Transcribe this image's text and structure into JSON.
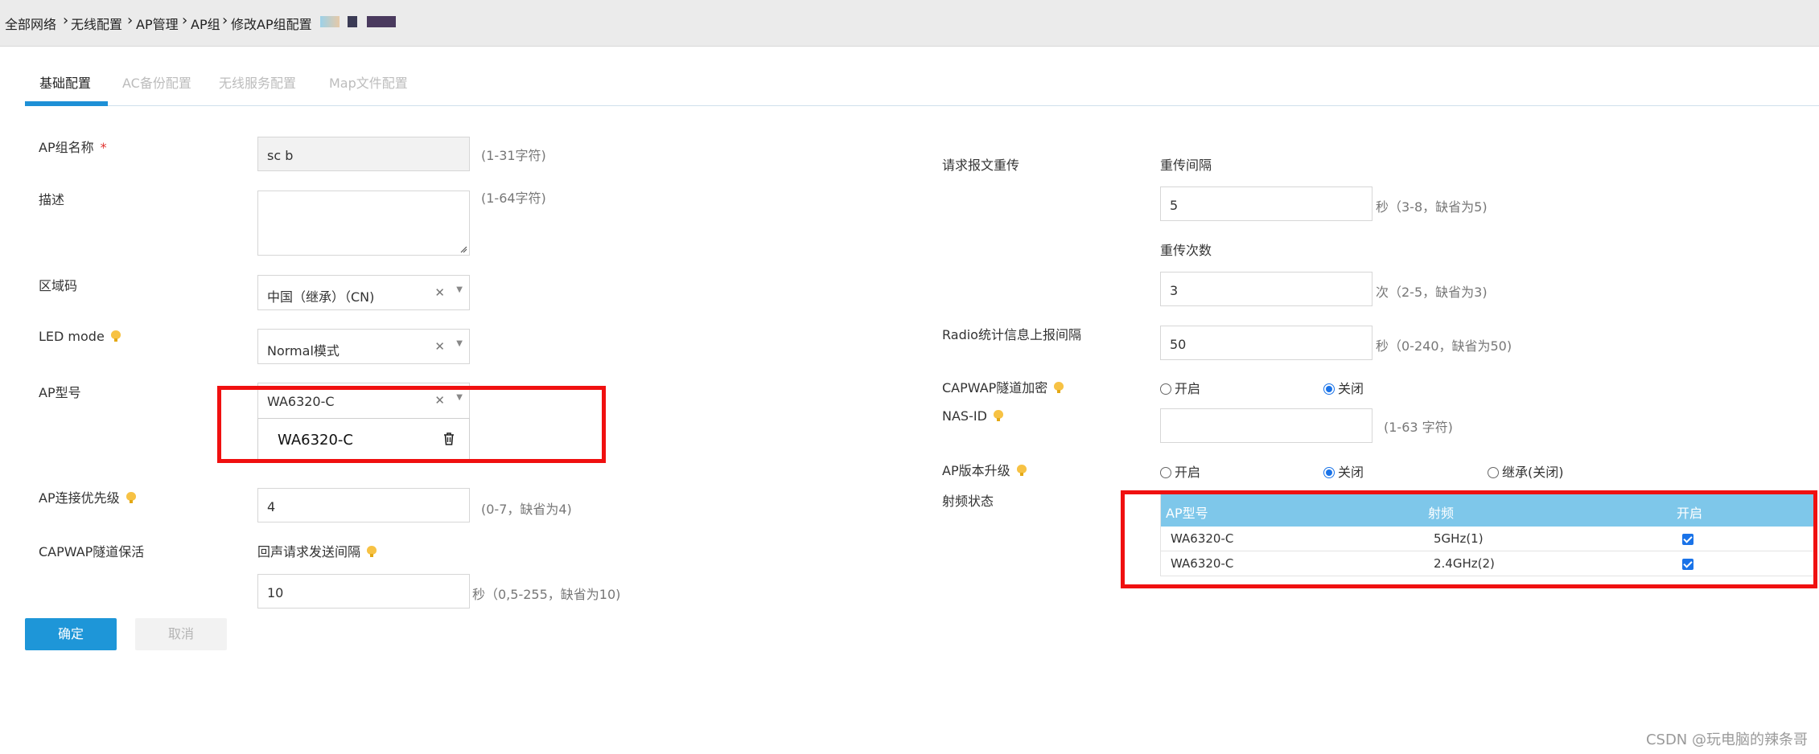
{
  "breadcrumb": {
    "items": [
      "全部网络",
      "无线配置",
      "AP管理",
      "AP组",
      "修改AP组配置"
    ],
    "separator": "›"
  },
  "tabs": [
    "基础配置",
    "AC备份配置",
    "无线服务配置",
    "Map文件配置"
  ],
  "left": {
    "group_name": {
      "label": "AP组名称",
      "required_mark": "*",
      "value": "sc      b",
      "hint": "(1-31字符)"
    },
    "description": {
      "label": "描述",
      "value": "",
      "hint": "(1-64字符)"
    },
    "region_code": {
      "label": "区域码",
      "value": "中国（继承）（CN)"
    },
    "led_mode": {
      "label": "LED mode",
      "value": "Normal模式"
    },
    "ap_model": {
      "label": "AP型号",
      "value": "WA6320-C",
      "selected_chip": "WA6320-C"
    },
    "priority": {
      "label": "AP连接优先级",
      "value": "4",
      "hint": "(0-7，缺省为4)"
    },
    "keepalive": {
      "label": "CAPWAP隧道保活",
      "sub_label": "回声请求发送间隔",
      "value": "10",
      "hint": "秒（0,5-255，缺省为10)"
    }
  },
  "right": {
    "retransmit": {
      "label": "请求报文重传",
      "interval_label": "重传间隔",
      "interval_value": "5",
      "interval_hint": "秒（3-8，缺省为5)",
      "count_label": "重传次数",
      "count_value": "3",
      "count_hint": "次（2-5，缺省为3)"
    },
    "radio_stats": {
      "label": "Radio统计信息上报间隔",
      "value": "50",
      "hint": "秒（0-240，缺省为50)"
    },
    "capwap_encrypt": {
      "label": "CAPWAP隧道加密",
      "options": [
        "开启",
        "关闭"
      ],
      "selected": "关闭"
    },
    "nas_id": {
      "label": "NAS-ID",
      "value": "",
      "hint": "(1-63 字符)"
    },
    "ap_upgrade": {
      "label": "AP版本升级",
      "options": [
        "开启",
        "关闭",
        "继承(关闭)"
      ],
      "selected": "关闭"
    },
    "radio_state": {
      "label": "射频状态",
      "columns": [
        "AP型号",
        "射频",
        "开启"
      ],
      "rows": [
        {
          "model": "WA6320-C",
          "radio": "5GHz(1)",
          "enabled": true
        },
        {
          "model": "WA6320-C",
          "radio": "2.4GHz(2)",
          "enabled": true
        }
      ]
    }
  },
  "buttons": {
    "ok": "确定",
    "cancel": "取消"
  },
  "watermark": "CSDN @玩电脑的辣条哥",
  "colors": {
    "accent": "#1e96d8",
    "table_header": "#7ec7ea",
    "highlight_box": "#f01010",
    "bulb": "#f7c244"
  }
}
